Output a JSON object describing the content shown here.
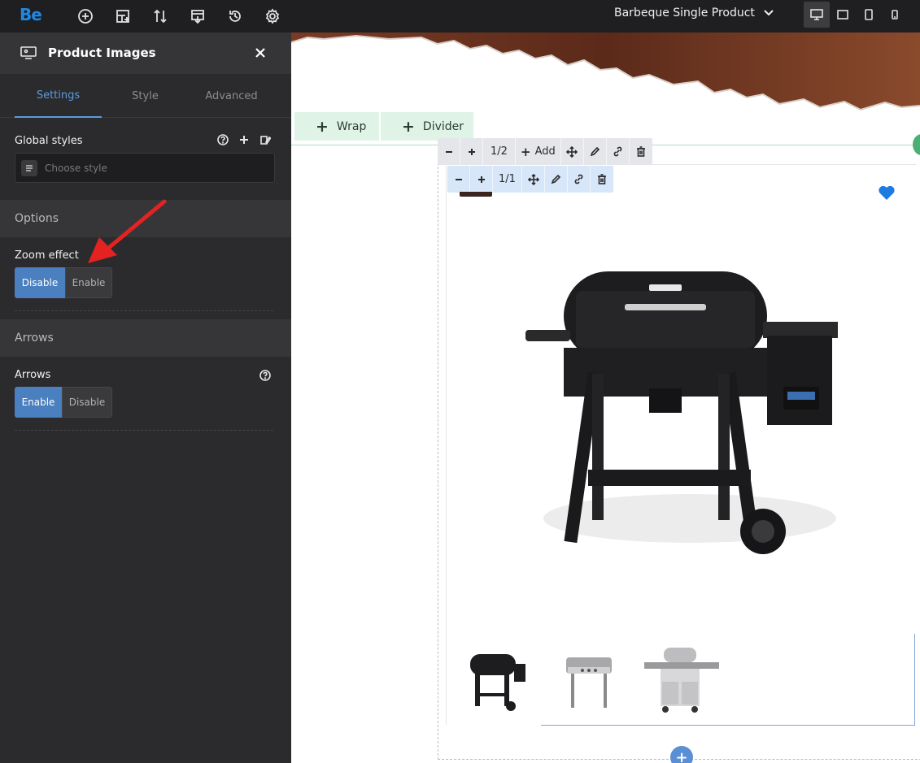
{
  "topbar": {
    "logo": "Be",
    "icons": [
      "add-circle-icon",
      "layout-add-icon",
      "sort-icon",
      "export-icon",
      "history-icon",
      "settings-icon"
    ],
    "page_selector": "Barbeque Single Product",
    "devices": [
      "desktop-icon",
      "laptop-icon",
      "tablet-icon",
      "mobile-icon"
    ],
    "active_device": "desktop-icon"
  },
  "panel": {
    "title": "Product Images",
    "tabs": [
      {
        "label": "Settings",
        "active": true
      },
      {
        "label": "Style",
        "active": false
      },
      {
        "label": "Advanced",
        "active": false
      }
    ],
    "global_styles": {
      "label": "Global styles",
      "placeholder": "Choose style"
    },
    "sections": {
      "options": "Options",
      "arrows": "Arrows"
    },
    "zoom_effect": {
      "label": "Zoom effect",
      "options": [
        "Disable",
        "Enable"
      ],
      "selected": "Disable"
    },
    "arrows_field": {
      "label": "Arrows",
      "options": [
        "Enable",
        "Disable"
      ],
      "selected": "Enable"
    }
  },
  "canvas": {
    "wrap_button": "Wrap",
    "divider_button": "Divider",
    "toolbar_outer": {
      "ratio": "1/2",
      "add_label": "Add"
    },
    "toolbar_inner": {
      "ratio": "1/1"
    },
    "colors": {
      "accent": "#4a7fc0",
      "heart": "#1e7be0",
      "green": "#4caf72"
    }
  }
}
